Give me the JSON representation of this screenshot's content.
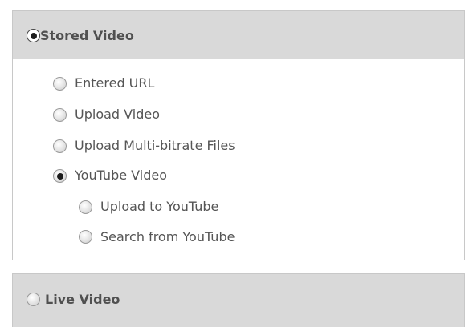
{
  "stored_video": {
    "label": "Stored Video",
    "selected": true,
    "options": [
      {
        "label": "Entered URL",
        "selected": false
      },
      {
        "label": "Upload Video",
        "selected": false
      },
      {
        "label": "Upload Multi-bitrate Files",
        "selected": false
      },
      {
        "label": "YouTube Video",
        "selected": true,
        "sub_options": [
          {
            "label": "Upload to YouTube",
            "selected": false
          },
          {
            "label": "Search from YouTube",
            "selected": false
          }
        ]
      }
    ]
  },
  "live_video": {
    "label": "Live Video",
    "selected": false
  }
}
